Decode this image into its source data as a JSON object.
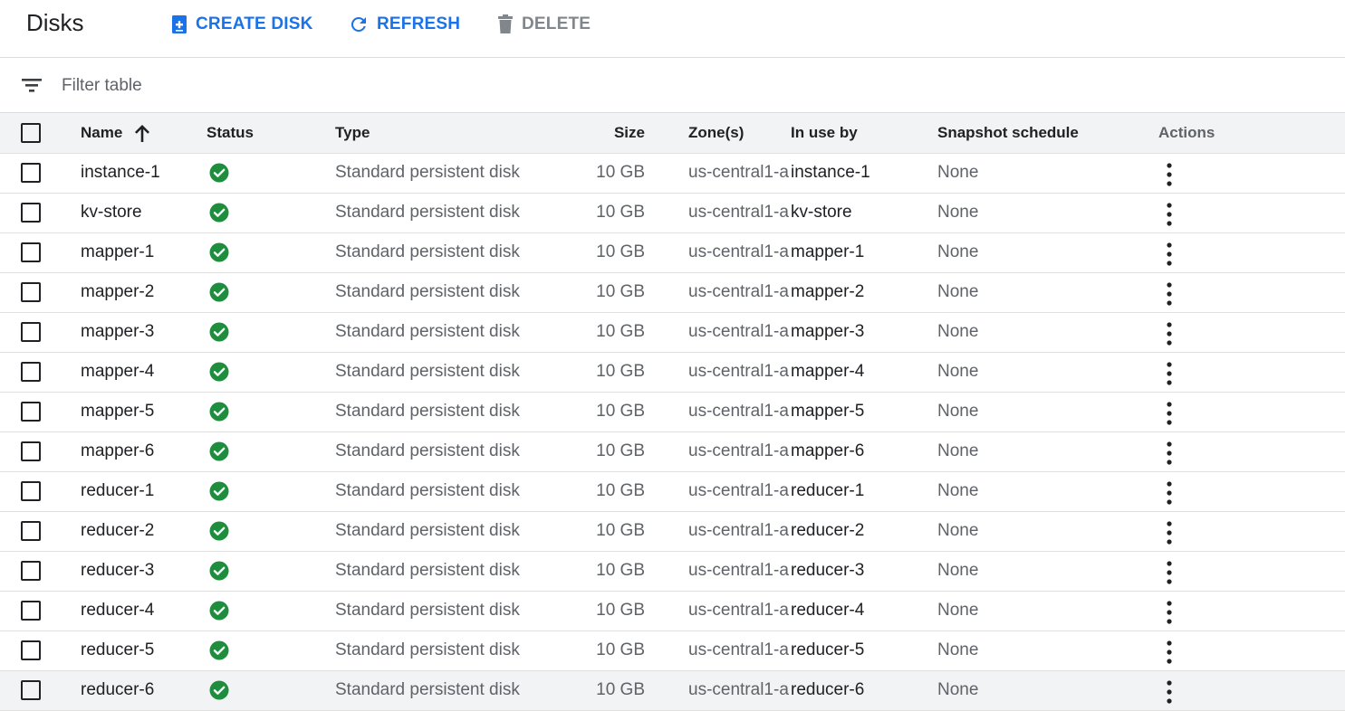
{
  "toolbar": {
    "title": "Disks",
    "create_label": "CREATE DISK",
    "refresh_label": "REFRESH",
    "delete_label": "DELETE"
  },
  "filter": {
    "placeholder": "Filter table"
  },
  "colors": {
    "accent": "#1a73e8",
    "status_ok": "#1e8e3e",
    "header_bg": "#f1f3f4",
    "secondary_text": "#5f6368"
  },
  "table": {
    "headers": {
      "name": "Name",
      "status": "Status",
      "type": "Type",
      "size": "Size",
      "zone": "Zone(s)",
      "in_use_by": "In use by",
      "snapshot": "Snapshot schedule",
      "actions": "Actions"
    },
    "sort": {
      "column": "name",
      "direction": "ascending",
      "icon": "arrow-up-icon"
    },
    "rows": [
      {
        "name": "instance-1",
        "status": "ready",
        "type": "Standard persistent disk",
        "size": "10 GB",
        "zone": "us-central1-a",
        "in_use_by": "instance-1",
        "snapshot": "None"
      },
      {
        "name": "kv-store",
        "status": "ready",
        "type": "Standard persistent disk",
        "size": "10 GB",
        "zone": "us-central1-a",
        "in_use_by": "kv-store",
        "snapshot": "None"
      },
      {
        "name": "mapper-1",
        "status": "ready",
        "type": "Standard persistent disk",
        "size": "10 GB",
        "zone": "us-central1-a",
        "in_use_by": "mapper-1",
        "snapshot": "None"
      },
      {
        "name": "mapper-2",
        "status": "ready",
        "type": "Standard persistent disk",
        "size": "10 GB",
        "zone": "us-central1-a",
        "in_use_by": "mapper-2",
        "snapshot": "None"
      },
      {
        "name": "mapper-3",
        "status": "ready",
        "type": "Standard persistent disk",
        "size": "10 GB",
        "zone": "us-central1-a",
        "in_use_by": "mapper-3",
        "snapshot": "None"
      },
      {
        "name": "mapper-4",
        "status": "ready",
        "type": "Standard persistent disk",
        "size": "10 GB",
        "zone": "us-central1-a",
        "in_use_by": "mapper-4",
        "snapshot": "None"
      },
      {
        "name": "mapper-5",
        "status": "ready",
        "type": "Standard persistent disk",
        "size": "10 GB",
        "zone": "us-central1-a",
        "in_use_by": "mapper-5",
        "snapshot": "None"
      },
      {
        "name": "mapper-6",
        "status": "ready",
        "type": "Standard persistent disk",
        "size": "10 GB",
        "zone": "us-central1-a",
        "in_use_by": "mapper-6",
        "snapshot": "None"
      },
      {
        "name": "reducer-1",
        "status": "ready",
        "type": "Standard persistent disk",
        "size": "10 GB",
        "zone": "us-central1-a",
        "in_use_by": "reducer-1",
        "snapshot": "None"
      },
      {
        "name": "reducer-2",
        "status": "ready",
        "type": "Standard persistent disk",
        "size": "10 GB",
        "zone": "us-central1-a",
        "in_use_by": "reducer-2",
        "snapshot": "None"
      },
      {
        "name": "reducer-3",
        "status": "ready",
        "type": "Standard persistent disk",
        "size": "10 GB",
        "zone": "us-central1-a",
        "in_use_by": "reducer-3",
        "snapshot": "None"
      },
      {
        "name": "reducer-4",
        "status": "ready",
        "type": "Standard persistent disk",
        "size": "10 GB",
        "zone": "us-central1-a",
        "in_use_by": "reducer-4",
        "snapshot": "None"
      },
      {
        "name": "reducer-5",
        "status": "ready",
        "type": "Standard persistent disk",
        "size": "10 GB",
        "zone": "us-central1-a",
        "in_use_by": "reducer-5",
        "snapshot": "None"
      },
      {
        "name": "reducer-6",
        "status": "ready",
        "type": "Standard persistent disk",
        "size": "10 GB",
        "zone": "us-central1-a",
        "in_use_by": "reducer-6",
        "snapshot": "None"
      }
    ],
    "highlighted_row": 13
  }
}
